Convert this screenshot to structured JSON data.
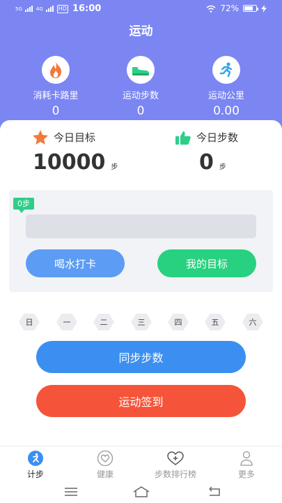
{
  "status_bar": {
    "signal_1": "5G",
    "signal_2": "4G",
    "hd": "HD",
    "time": "16:00",
    "battery": "72%"
  },
  "header": {
    "title": "运动"
  },
  "stats": [
    {
      "label": "消耗卡路里",
      "value": "0",
      "icon": "flame-icon"
    },
    {
      "label": "运动步数",
      "value": "0",
      "icon": "shoe-icon"
    },
    {
      "label": "运动公里",
      "value": "0.00",
      "icon": "runner-icon"
    }
  ],
  "goal": {
    "label": "今日目标",
    "value": "10000",
    "unit": "步",
    "icon": "star-icon"
  },
  "steps": {
    "label": "今日步数",
    "value": "0",
    "unit": "步",
    "icon": "thumbs-up-icon"
  },
  "progress": {
    "badge": "0步",
    "percent": 0
  },
  "actions": {
    "water": "喝水打卡",
    "my_goal": "我的目标"
  },
  "week": [
    "日",
    "一",
    "二",
    "三",
    "四",
    "五",
    "六"
  ],
  "buttons": {
    "sync": "同步步数",
    "sign_in": "运动签到"
  },
  "tabs": [
    {
      "label": "计步",
      "icon": "pedometer-icon",
      "active": true
    },
    {
      "label": "健康",
      "icon": "heart-icon",
      "active": false
    },
    {
      "label": "步数排行榜",
      "icon": "heart-plus-icon",
      "active": false
    },
    {
      "label": "更多",
      "icon": "person-icon",
      "active": false
    }
  ],
  "colors": {
    "header": "#7b86f2",
    "green": "#27d17f",
    "blue": "#3b8ff0",
    "red": "#f5543a",
    "orange": "#f07a3c"
  }
}
